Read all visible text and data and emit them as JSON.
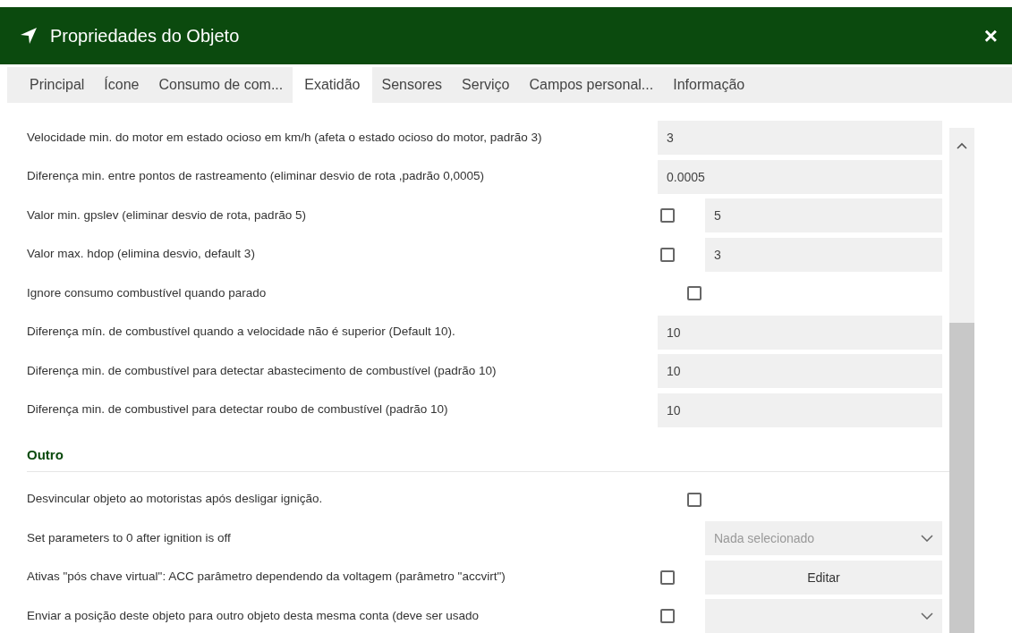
{
  "window": {
    "title": "Propriedades do Objeto",
    "close": "×"
  },
  "tabs": [
    {
      "label": "Principal",
      "selected": false
    },
    {
      "label": "Ícone",
      "selected": false
    },
    {
      "label": "Consumo de com...",
      "selected": false
    },
    {
      "label": "Exatidão",
      "selected": true
    },
    {
      "label": "Sensores",
      "selected": false
    },
    {
      "label": "Serviço",
      "selected": false
    },
    {
      "label": "Campos personal...",
      "selected": false
    },
    {
      "label": "Informação",
      "selected": false
    }
  ],
  "sections": [
    {
      "rows": [
        {
          "kind": "input",
          "label": "Velocidade min. do motor em estado ocioso em km/h (afeta o estado ocioso do motor, padrão 3)",
          "value": "3"
        },
        {
          "kind": "input",
          "label": "Diferença min. entre pontos de rastreamento (eliminar desvio de rota ,padrão 0,0005)",
          "value": "0.0005"
        },
        {
          "kind": "check_input",
          "label": "Valor min. gpslev (eliminar desvio de rota, padrão 5)",
          "checked": false,
          "value": "5"
        },
        {
          "kind": "check_input",
          "label": "Valor max. hdop (elimina desvio, default 3)",
          "checked": false,
          "value": "3"
        },
        {
          "kind": "check",
          "label": "Ignore consumo combustível quando parado",
          "checked": false
        },
        {
          "kind": "input",
          "label": "Diferença mín. de combustível quando a velocidade não é superior (Default 10).",
          "value": "10"
        },
        {
          "kind": "input",
          "label": "Diferença min. de combustível para detectar abastecimento de combustível (padrão 10)",
          "value": "10"
        },
        {
          "kind": "input",
          "label": "Diferença min. de combustivel para detectar roubo de combustível (padrão 10)",
          "value": "10"
        }
      ]
    },
    {
      "title": "Outro",
      "rows": [
        {
          "kind": "check",
          "label": "Desvincular objeto ao motoristas após desligar ignição.",
          "checked": false
        },
        {
          "kind": "select",
          "label": "Set parameters to 0 after ignition is off",
          "placeholder": "Nada selecionado"
        },
        {
          "kind": "check_button",
          "label": "Ativas \"pós chave virtual\": ACC parâmetro dependendo da voltagem (parâmetro \"accvirt\")",
          "checked": false,
          "button": "Editar"
        },
        {
          "kind": "check_select",
          "label": "Enviar a posição deste objeto para outro objeto desta mesma conta (deve ser usado",
          "checked": false
        }
      ]
    }
  ]
}
